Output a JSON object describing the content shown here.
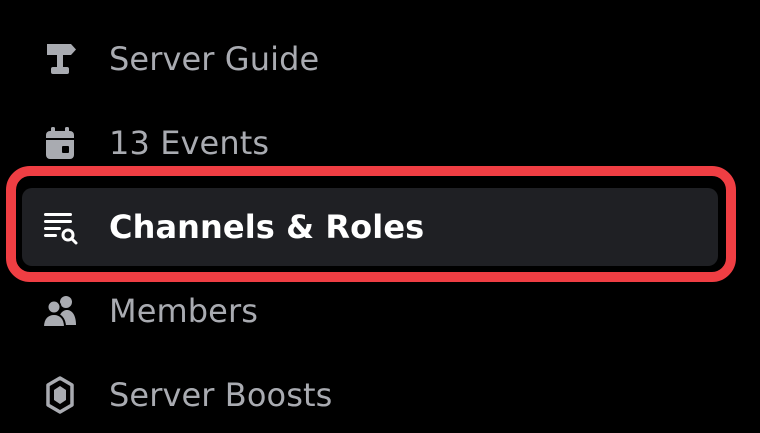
{
  "sidebar": {
    "items": [
      {
        "label": "Server Guide",
        "icon": "signpost-icon",
        "selected": false
      },
      {
        "label": "13 Events",
        "icon": "calendar-icon",
        "selected": false
      },
      {
        "label": "Channels & Roles",
        "icon": "channel-browse-icon",
        "selected": true
      },
      {
        "label": "Members",
        "icon": "members-icon",
        "selected": false
      },
      {
        "label": "Server Boosts",
        "icon": "boost-gem-icon",
        "selected": false
      }
    ]
  },
  "colors": {
    "background": "#000000",
    "item_text": "#a9abb1",
    "icon": "#a9abb1",
    "selected_background": "#1f2024",
    "selected_text": "#ffffff",
    "highlight_border": "#ef3e43"
  }
}
